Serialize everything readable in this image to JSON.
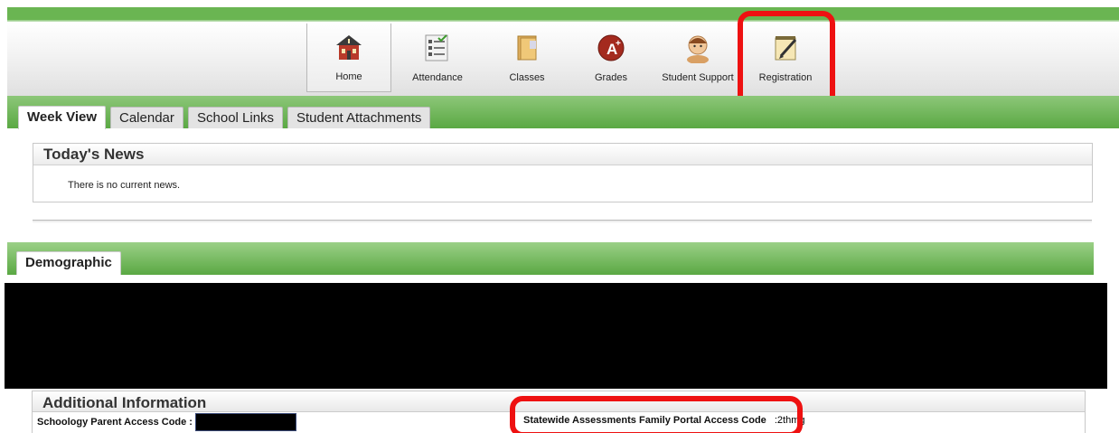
{
  "nav": {
    "items": [
      {
        "label": "Home",
        "icon": "schoolhouse-icon",
        "active": true
      },
      {
        "label": "Attendance",
        "icon": "checklist-icon"
      },
      {
        "label": "Classes",
        "icon": "books-icon"
      },
      {
        "label": "Grades",
        "icon": "grade-a-plus-icon"
      },
      {
        "label": "Student Support",
        "icon": "student-face-icon"
      },
      {
        "label": "Registration",
        "icon": "notepad-pencil-icon"
      }
    ]
  },
  "tabs": [
    "Week View",
    "Calendar",
    "School Links",
    "Student Attachments"
  ],
  "news": {
    "title": "Today's News",
    "message": "There is no current news."
  },
  "subtabs": [
    "Demographic"
  ],
  "additional": {
    "title": "Additional Information",
    "schoology_label": "Schoology Parent Access Code :",
    "statewide_label": "Statewide Assessments Family Portal Access Code",
    "statewide_value": ":2thmg"
  },
  "colors": {
    "green": "#6ab552",
    "highlight": "#ee1111"
  }
}
